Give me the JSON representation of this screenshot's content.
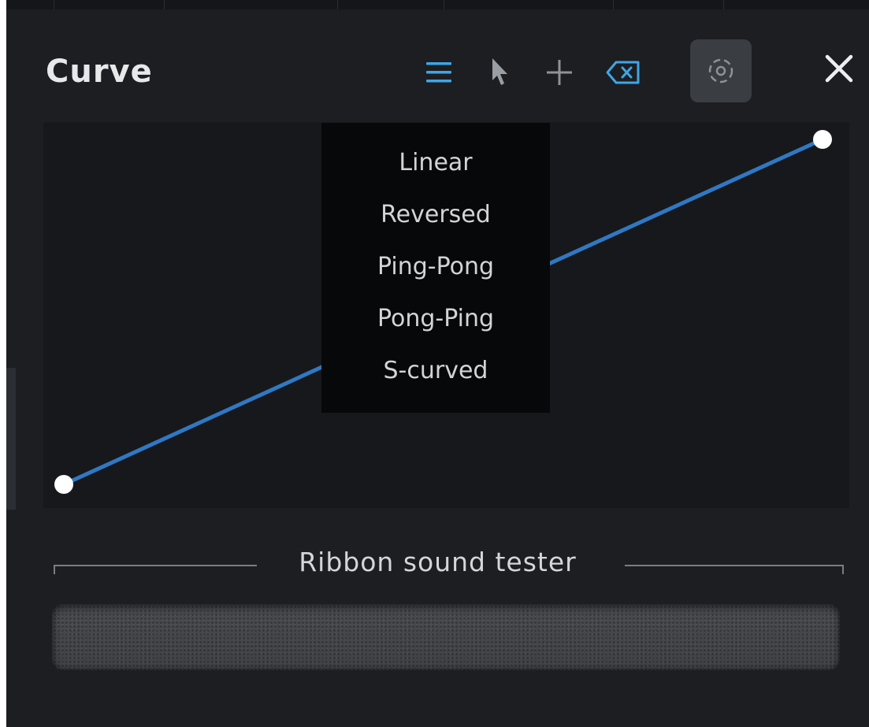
{
  "panel": {
    "title": "Curve"
  },
  "toolbar": {
    "icons": [
      "menu-icon",
      "pointer-icon",
      "add-icon",
      "delete-icon",
      "focus-icon",
      "close-icon"
    ],
    "accent_color": "#3ea6e6"
  },
  "curve": {
    "line_color": "#2f78c4",
    "points": [
      {
        "x": 0,
        "y": 0
      },
      {
        "x": 1,
        "y": 1
      }
    ]
  },
  "curve_menu": {
    "items": [
      {
        "label": "Linear"
      },
      {
        "label": "Reversed"
      },
      {
        "label": "Ping-Pong"
      },
      {
        "label": "Pong-Ping"
      },
      {
        "label": "S-curved"
      }
    ]
  },
  "ribbon_tester": {
    "label": "Ribbon sound tester"
  }
}
